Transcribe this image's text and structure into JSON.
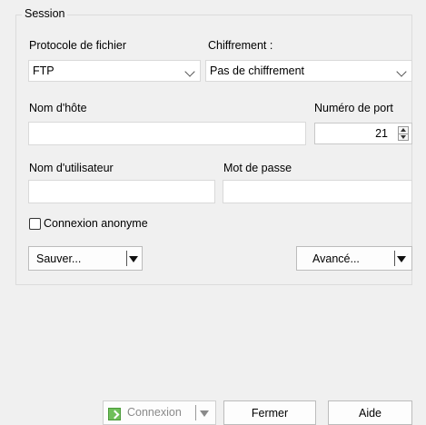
{
  "session": {
    "group_title": "Session",
    "protocol_label": "Protocole de fichier",
    "protocol_value": "FTP",
    "encryption_label": "Chiffrement :",
    "encryption_value": "Pas de chiffrement",
    "host_label": "Nom d'hôte",
    "host_value": "",
    "port_label": "Numéro de port",
    "port_value": "21",
    "user_label": "Nom d'utilisateur",
    "user_value": "",
    "password_label": "Mot de passe",
    "password_value": "",
    "anonymous_label": "Connexion anonyme",
    "anonymous_checked": false,
    "save_button": "Sauver...",
    "advanced_button": "Avancé..."
  },
  "footer": {
    "connect_button": "Connexion",
    "close_button": "Fermer",
    "help_button": "Aide"
  },
  "icons": {
    "connect": "login-icon",
    "dropdown": "chevron-down-icon",
    "spinner": "spinner-arrows-icon"
  }
}
